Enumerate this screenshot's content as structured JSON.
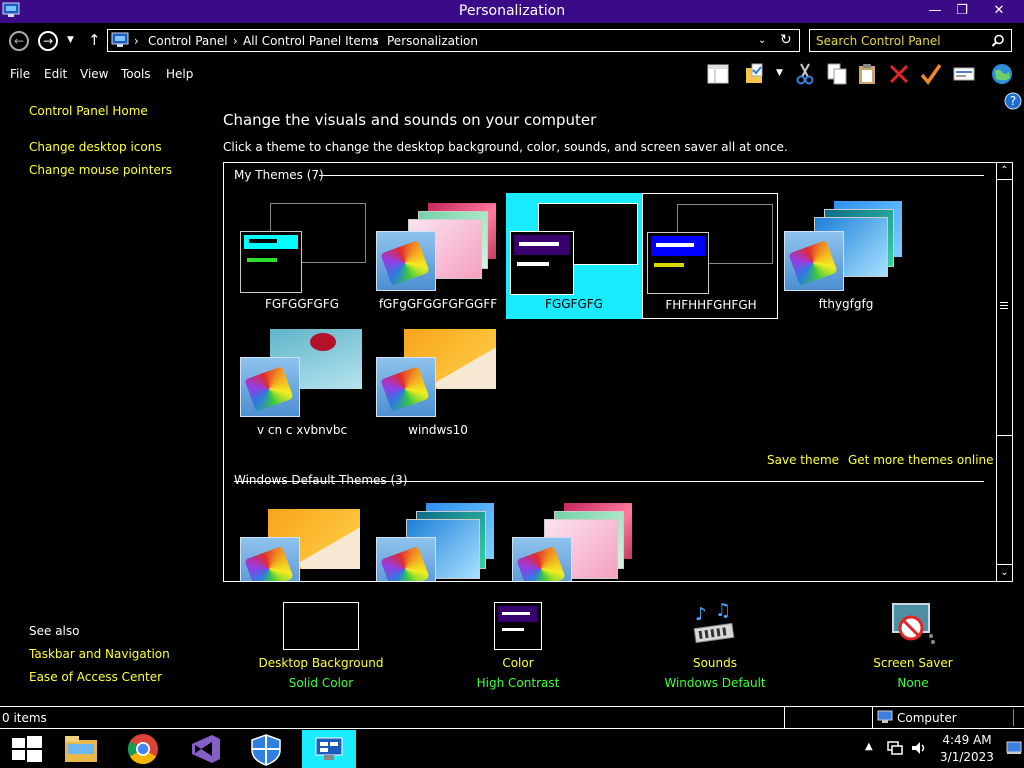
{
  "window": {
    "title": "Personalization",
    "minimize_glyph": "—",
    "maximize_glyph": "❐",
    "close_glyph": "✕"
  },
  "address": {
    "crumbs": [
      "Control Panel",
      "All Control Panel Items",
      "Personalization"
    ],
    "search_placeholder": "Search Control Panel"
  },
  "menu": [
    "File",
    "Edit",
    "View",
    "Tools",
    "Help"
  ],
  "toolbar_icons": [
    "layout-icon",
    "folder-options-icon",
    "cut-icon",
    "copy-icon",
    "paste-icon",
    "delete-icon",
    "check-icon",
    "properties-icon",
    "globe-icon"
  ],
  "left_pane": {
    "home": "Control Panel Home",
    "links": [
      "Change desktop icons",
      "Change mouse pointers"
    ],
    "see_also_title": "See also",
    "see_also": [
      "Taskbar and Navigation",
      "Ease of Access Center"
    ]
  },
  "main": {
    "heading": "Change the visuals and sounds on your computer",
    "subtext": "Click a theme to change the desktop background, color, sounds, and screen saver all at once.",
    "my_themes_header": "My Themes (7)",
    "my_themes": [
      "FGFGGFGFG",
      "fGFgGFGGFGFGGFF",
      "FGGFGFG",
      "FHFHHFGHFGH",
      "fthygfgfg",
      "v cn c xvbnvbc",
      "windws10"
    ],
    "save_theme": "Save theme",
    "get_more": "Get more themes online",
    "default_header": "Windows Default Themes (3)"
  },
  "bottom": {
    "background": {
      "label": "Desktop Background",
      "value": "Solid Color"
    },
    "color": {
      "label": "Color",
      "value": "High Contrast"
    },
    "sounds": {
      "label": "Sounds",
      "value": "Windows Default"
    },
    "screensaver": {
      "label": "Screen Saver",
      "value": "None"
    }
  },
  "status": {
    "items": "0 items",
    "location": "Computer"
  },
  "clock": {
    "time": "4:49 AM",
    "date": "3/1/2023"
  },
  "colors": {
    "titlebar": "#3b0a86",
    "link": "#ffff3c",
    "value": "#3dff3d",
    "selected": "#1aebff"
  }
}
